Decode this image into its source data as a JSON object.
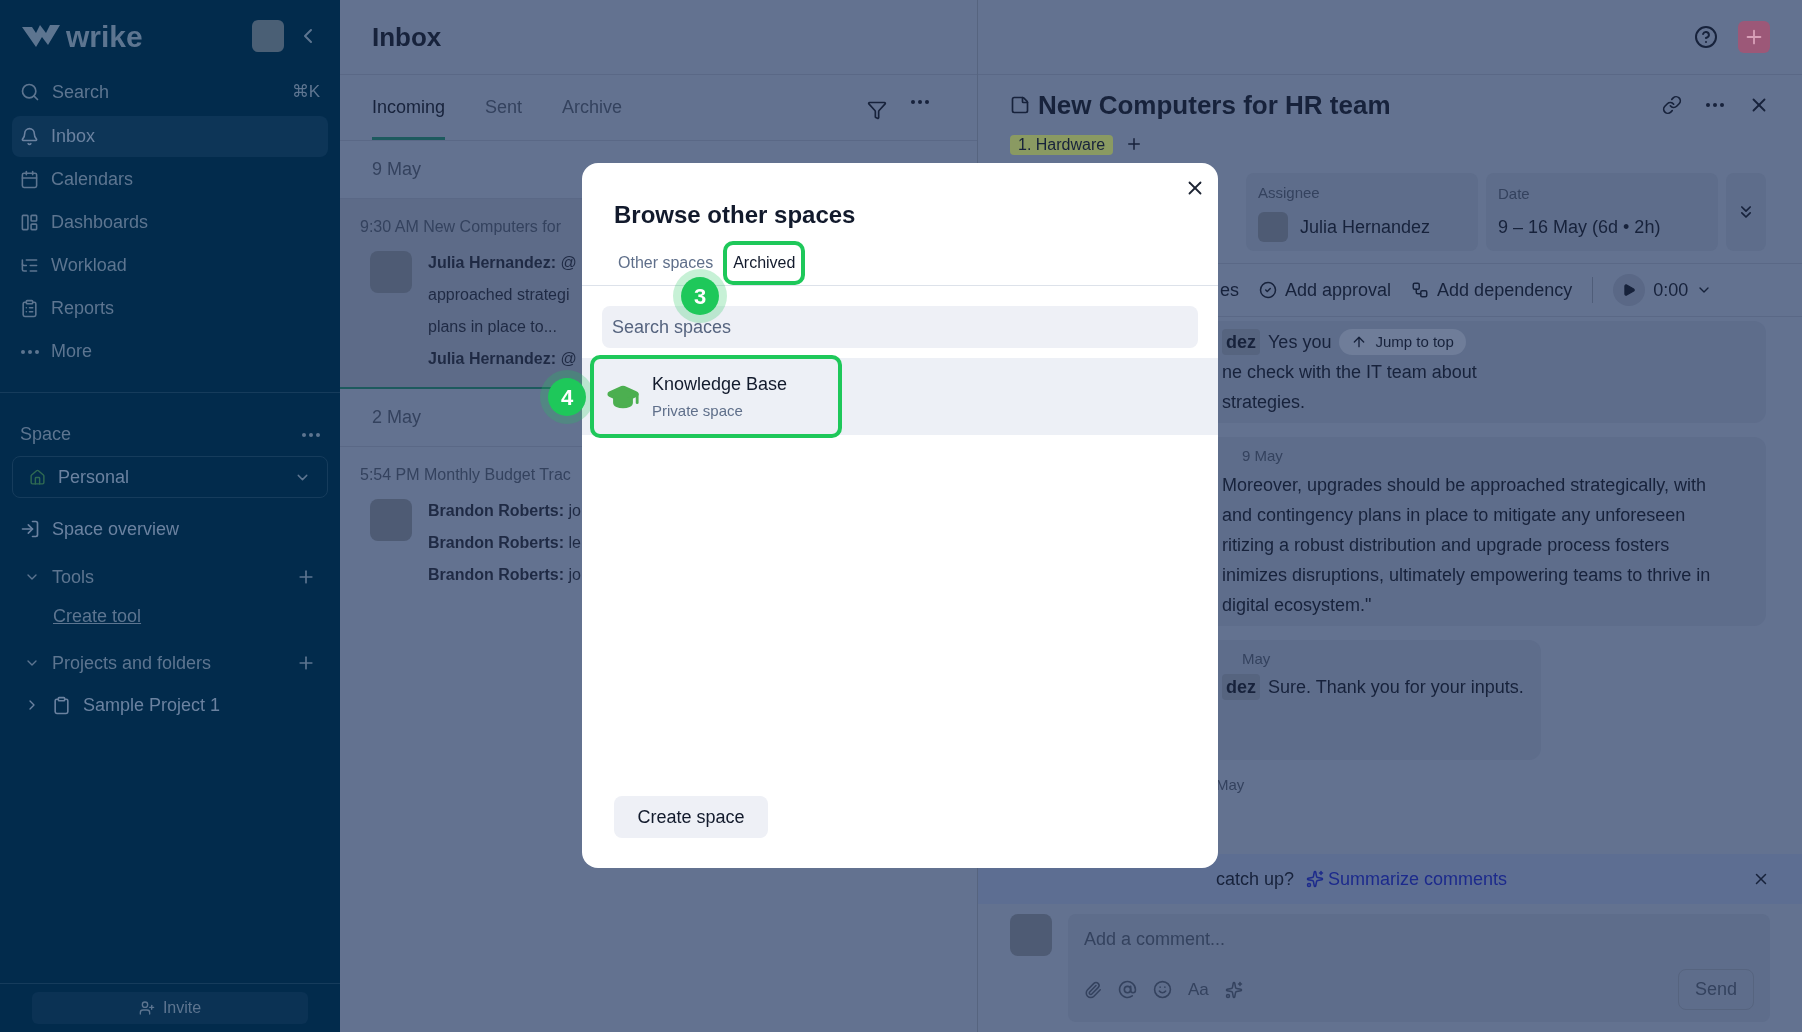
{
  "sidebar": {
    "logo": "wrike",
    "search": {
      "label": "Search",
      "shortcut": "⌘K"
    },
    "nav": [
      {
        "label": "Inbox",
        "selected": true
      },
      {
        "label": "Calendars",
        "selected": false
      },
      {
        "label": "Dashboards",
        "selected": false
      },
      {
        "label": "Workload",
        "selected": false
      },
      {
        "label": "Reports",
        "selected": false
      },
      {
        "label": "More",
        "selected": false
      }
    ],
    "space_label": "Space",
    "space_selector": "Personal",
    "space_overview": "Space overview",
    "sections": [
      {
        "label": "Tools",
        "expanded": true,
        "children": [
          {
            "label": "Create tool",
            "kind": "link"
          }
        ]
      },
      {
        "label": "Projects and folders",
        "expanded": true,
        "children": [
          {
            "label": "Sample Project 1",
            "kind": "project"
          }
        ]
      }
    ],
    "invite": "Invite"
  },
  "inbox": {
    "title": "Inbox",
    "tabs": [
      {
        "label": "Incoming",
        "selected": true
      },
      {
        "label": "Sent",
        "selected": false
      },
      {
        "label": "Archive",
        "selected": false
      }
    ],
    "groups": [
      {
        "date": "9 May",
        "selected": true,
        "items": [
          {
            "header": "9:30 AM New Computers for",
            "lines": [
              "**Julia Hernandez:** @",
              "approached strategi",
              "plans in place to...",
              "**Julia Hernandez:** @"
            ]
          }
        ]
      },
      {
        "date": "2 May",
        "selected": false,
        "items": [
          {
            "header": "5:54 PM Monthly Budget Trac",
            "lines": [
              "**Brandon Roberts:** jo",
              "**Brandon Roberts:** le",
              "**Brandon Roberts:** jo"
            ]
          }
        ]
      }
    ]
  },
  "task": {
    "title": "New Computers for HR team",
    "tag": "1. Hardware",
    "fields": [
      {
        "label": "Assignee",
        "value": "Julia Hernandez",
        "avatar": true
      },
      {
        "label": "Date",
        "value": "9 – 16 May (6d • 2h)",
        "avatar": false
      }
    ],
    "actions": [
      "es",
      "Add approval",
      "Add dependency"
    ],
    "timer": "0:00",
    "jump": "Jump to top",
    "comments": [
      {
        "mention": "dez",
        "lines": [
          "Yes you",
          "ne check with the IT team about",
          "strategies."
        ]
      },
      {
        "meta": "9 May",
        "lines": [
          "Moreover, upgrades should be approached strategically, with",
          "and contingency plans in place to mitigate any unforeseen",
          "ritizing a robust distribution and upgrade process fosters",
          "inimizes disruptions, ultimately empowering teams to thrive in",
          "digital ecosystem.\""
        ]
      },
      {
        "mention": "dez",
        "meta": "May",
        "lines": [
          "Sure. Thank you for your inputs."
        ]
      }
    ],
    "last_meta": "May",
    "summary": {
      "text": "catch up?",
      "link": "Summarize comments"
    },
    "comment_placeholder": "Add a comment...",
    "format": "Aa",
    "send": "Send"
  },
  "modal": {
    "title": "Browse other spaces",
    "tabs": [
      {
        "label": "Other spaces",
        "selected": false,
        "highlighted": false
      },
      {
        "label": "Archived",
        "selected": true,
        "highlighted": true,
        "badge": "3"
      }
    ],
    "search_placeholder": "Search spaces",
    "spaces": [
      {
        "name": "Knowledge Base",
        "subtitle": "Private space",
        "highlighted": true,
        "badge": "4"
      }
    ],
    "create": "Create space"
  }
}
